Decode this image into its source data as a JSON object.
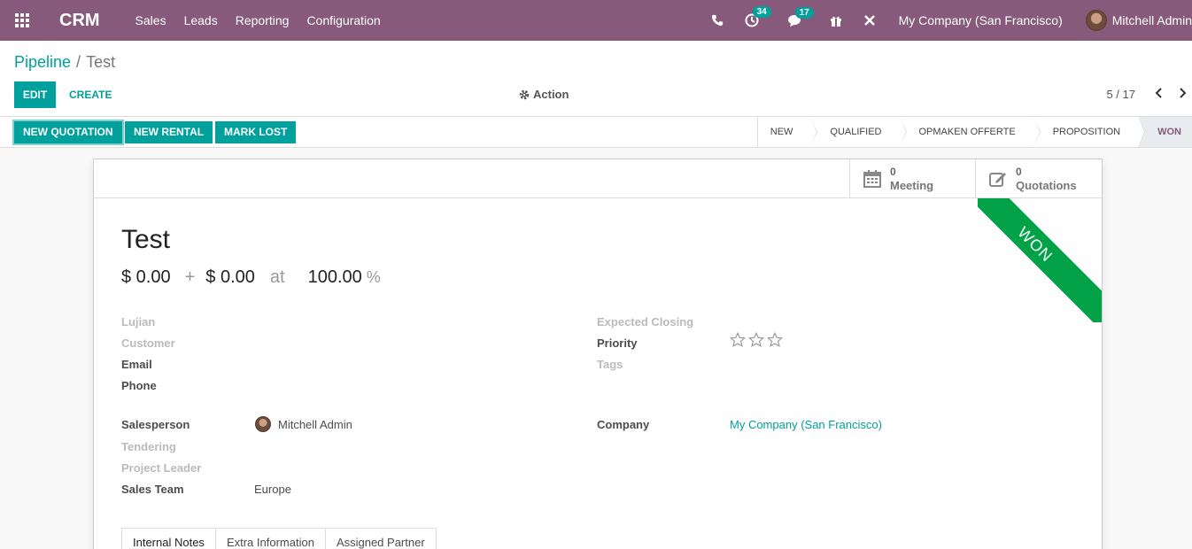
{
  "navbar": {
    "brand": "CRM",
    "menu": [
      "Sales",
      "Leads",
      "Reporting",
      "Configuration"
    ],
    "activity_count": "34",
    "message_count": "17",
    "company": "My Company (San Francisco)",
    "user": "Mitchell Admin"
  },
  "breadcrumb": {
    "parent": "Pipeline",
    "separator": "/",
    "current": "Test"
  },
  "control": {
    "edit_label": "EDIT",
    "create_label": "CREATE",
    "action_label": "Action",
    "pager": "5 / 17"
  },
  "statusbar": {
    "buttons": [
      "NEW QUOTATION",
      "NEW RENTAL",
      "MARK LOST"
    ],
    "stages": [
      "NEW",
      "QUALIFIED",
      "OPMAKEN OFFERTE",
      "PROPOSITION",
      "WON"
    ],
    "active_stage": "WON"
  },
  "smart_buttons": [
    {
      "count": "0",
      "label": "Meeting",
      "icon": "calendar-icon"
    },
    {
      "count": "0",
      "label": "Quotations",
      "icon": "edit-icon"
    }
  ],
  "ribbon": "WON",
  "record": {
    "title": "Test",
    "expected_revenue": "$ 0.00",
    "plus": "+",
    "prorated_revenue": "$ 0.00",
    "at": "at",
    "probability": "100.00",
    "percent": "%"
  },
  "fields_left": {
    "lujian": "Lujian",
    "customer": "Customer",
    "email": "Email",
    "phone": "Phone",
    "salesperson": "Salesperson",
    "salesperson_value": "Mitchell Admin",
    "tendering": "Tendering",
    "project_leader": "Project Leader",
    "sales_team": "Sales Team",
    "sales_team_value": "Europe"
  },
  "fields_right": {
    "expected_closing": "Expected Closing",
    "priority": "Priority",
    "tags": "Tags",
    "company": "Company",
    "company_value": "My Company (San Francisco)"
  },
  "priority_stars": 0,
  "tabs": [
    "Internal Notes",
    "Extra Information",
    "Assigned Partner"
  ],
  "colors": {
    "navbar": "#875a7b",
    "accent": "#00a09d",
    "ribbon": "#00a147"
  }
}
